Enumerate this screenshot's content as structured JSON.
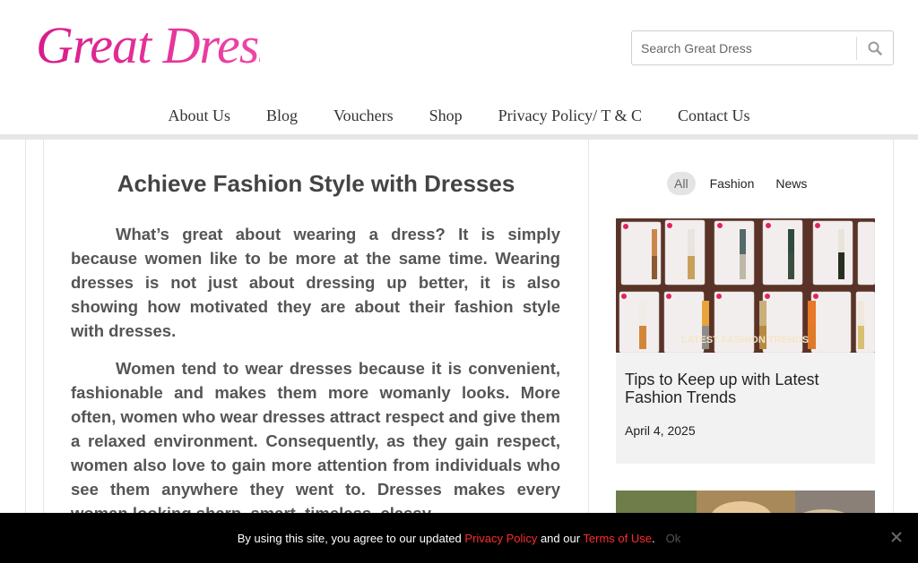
{
  "header": {
    "logo_text": "Great Dress",
    "search": {
      "placeholder": "Search Great Dress",
      "value": ""
    }
  },
  "nav": {
    "items": [
      "About Us",
      "Blog",
      "Vouchers",
      "Shop",
      "Privacy Policy/ T & C",
      "Contact Us"
    ]
  },
  "article": {
    "title": "Achieve Fashion Style with Dresses",
    "paragraphs": [
      "What’s great about wearing a dress? It is simply because women like to be more at the same time. Wearing dresses is not just about dressing up better, it is also showing how motivated they are about their fashion style with dresses.",
      "Women tend to wear dresses because it is convenient, fashionable and makes them more womanly looks. More often, women who wear dresses attract respect and give them a relaxed environment. Consequently, as they gain respect, women also love to gain more attention from individuals who see them anywhere they went to. Dresses makes every woman looking sharp, smart, timeless, classy"
    ]
  },
  "sidebar": {
    "filters": [
      {
        "label": "All",
        "active": true
      },
      {
        "label": "Fashion",
        "active": false
      },
      {
        "label": "News",
        "active": false
      }
    ],
    "post": {
      "image_caption": "LATEST FASHION TRENDS",
      "title": "Tips to Keep up with Latest Fashion Trends",
      "date": "April 4, 2025"
    }
  },
  "cookie": {
    "text_before": "By using this site, you agree to our updated ",
    "privacy_link": "Privacy Policy",
    "text_middle": " and our ",
    "terms_link": "Terms of Use",
    "text_after": ".",
    "ok_label": "Ok"
  },
  "colors": {
    "logo": "#e0218a",
    "cookie_link": "#ff2a2a",
    "cookie_bg": "#000000"
  }
}
